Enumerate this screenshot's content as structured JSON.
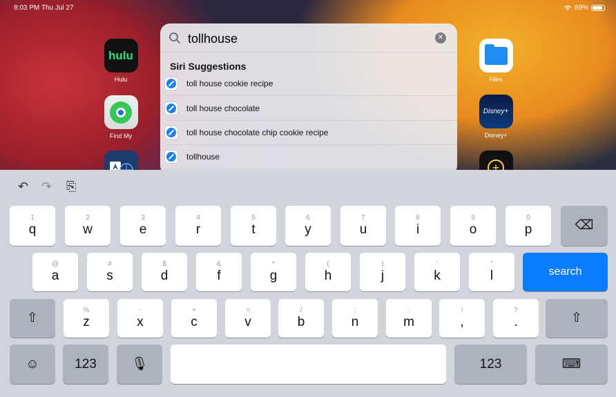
{
  "status": {
    "time": "8:03 PM  Thu Jul 27",
    "wifi": "wifi-icon",
    "battery": "89%",
    "battery_level": 0.89
  },
  "apps": {
    "hulu": {
      "label": "Hulu",
      "logo": "hulu"
    },
    "findmy": {
      "label": "Find My"
    },
    "files": {
      "label": "Files"
    },
    "disney": {
      "label": "Disney+",
      "logo": "Disney+"
    }
  },
  "search": {
    "query": "tollhouse",
    "clear_icon": "clear-icon"
  },
  "suggestions": {
    "title": "Siri Suggestions",
    "items": [
      "toll house cookie recipe",
      "toll house chocolate",
      "toll house chocolate chip cookie recipe",
      "tollhouse"
    ]
  },
  "keyboard": {
    "toolbar": {
      "undo": "↶",
      "redo": "↷",
      "paste": "⎘"
    },
    "row1": {
      "hints": [
        "1",
        "2",
        "3",
        "4",
        "5",
        "6",
        "7",
        "8",
        "9",
        "0"
      ],
      "keys": [
        "q",
        "w",
        "e",
        "r",
        "t",
        "y",
        "u",
        "i",
        "o",
        "p"
      ],
      "delete": "⌫"
    },
    "row2": {
      "hints": [
        "@",
        "#",
        "$",
        "&",
        "*",
        "(",
        ")",
        "'",
        "\""
      ],
      "keys": [
        "a",
        "s",
        "d",
        "f",
        "g",
        "h",
        "j",
        "k",
        "l"
      ],
      "action": "search"
    },
    "row3": {
      "hints": [
        "%",
        "-",
        "+",
        "=",
        "/",
        ";",
        ":",
        "!",
        "?"
      ],
      "keys": [
        "z",
        "x",
        "c",
        "v",
        "b",
        "n",
        "m",
        ",",
        "."
      ],
      "shift": "⇧"
    },
    "row4": {
      "emoji": "☺",
      "numbers": "123",
      "mic": "🎙",
      "numbers_right": "123",
      "hide": "⌨"
    }
  },
  "colors": {
    "accent": "#0a7cff",
    "hulu": "#1ce783"
  }
}
